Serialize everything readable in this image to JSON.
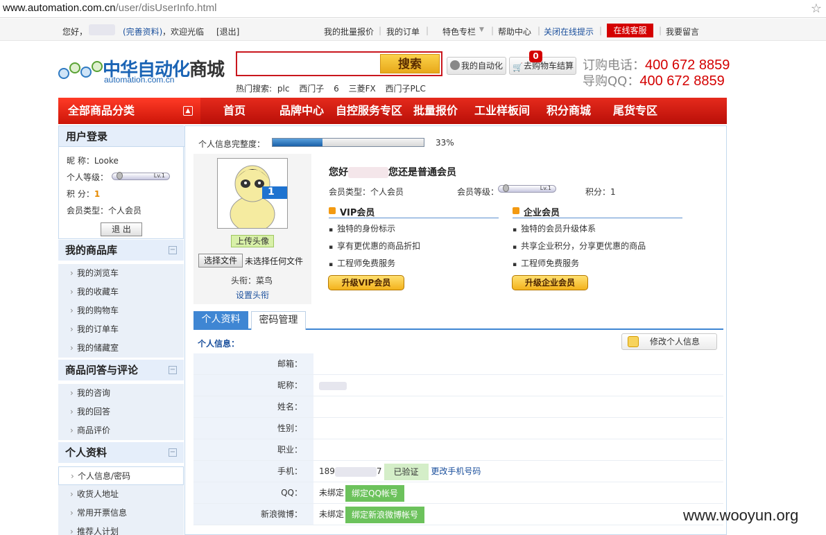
{
  "browser": {
    "url_domain": "www.automation.com.cn",
    "url_path": "/user/disUserInfo.html"
  },
  "topbar": {
    "greeting": "您好，",
    "complete_profile": "(完善资料)",
    "welcome": "，欢迎光临",
    "logout": "[退出]",
    "links": [
      "我的批量报价",
      "我的订单",
      "特色专栏",
      "帮助中心"
    ],
    "close_tip": "关闭在线提示",
    "online_service": "在线客服",
    "leave_message": "我要留言"
  },
  "logo": {
    "cn_blue": "中华自动化",
    "cn_gray": "商城",
    "en": "automation.com.cn"
  },
  "search": {
    "placeholder": "",
    "button": "搜索",
    "hot_label": "热门搜索:",
    "hot": [
      "plc",
      "西门子",
      "6",
      "三菱FX",
      "西门子PLC"
    ]
  },
  "header_buttons": {
    "my_auto": "我的自动化",
    "cart": "去购物车结算",
    "cart_count": "0"
  },
  "phone": {
    "order_label": "订购电话：",
    "order_number": "400 672 8859",
    "qq_label": "导购QQ：",
    "qq_number": "400 672 8859"
  },
  "nav": {
    "all": "全部商品分类",
    "items": [
      "首页",
      "品牌中心",
      "自控服务专区",
      "批量报价",
      "工业样板间",
      "积分商城",
      "尾货专区"
    ]
  },
  "sidebar": {
    "login_title": "用户登录",
    "nick_label": "昵 称：",
    "nick": "Looke",
    "level_label": "个人等级：",
    "points_label": "积 分：",
    "points": "1",
    "type_label": "会员类型：",
    "type": "个人会员",
    "logout_btn": "退 出",
    "sections": [
      {
        "title": "我的商品库",
        "items": [
          "我的浏览车",
          "我的收藏车",
          "我的购物车",
          "我的订单车",
          "我的储藏室"
        ]
      },
      {
        "title": "商品问答与评论",
        "items": [
          "我的咨询",
          "我的回答",
          "商品评价"
        ]
      },
      {
        "title": "个人资料",
        "items": [
          "个人信息/密码",
          "收货人地址",
          "常用开票信息",
          "推荐人计划"
        ]
      }
    ]
  },
  "profile": {
    "completeness_label": "个人信息完整度：",
    "completeness_value": "33%",
    "completeness_fraction": 0.33,
    "upload_avatar": "上传头像",
    "choose_file": "选择文件",
    "no_file": "未选择任何文件",
    "title_label": "头衔：菜鸟",
    "set_title": "设置头衔",
    "avatar_badge": "1",
    "hello_a": "您好",
    "hello_b": "您还是普通会员",
    "member_type": "会员类型：个人会员",
    "member_level": "会员等级：",
    "points": "积分：1",
    "level_tag": "Lv.1",
    "vip": {
      "title": "VIP会员",
      "bullets": [
        "独特的身份标示",
        "享有更优惠的商品折扣",
        "工程师免费服务"
      ],
      "button": "升级VIP会员"
    },
    "ent": {
      "title": "企业会员",
      "bullets": [
        "独特的会员升级体系",
        "共享企业积分，分享更优惠的商品",
        "工程师免费服务"
      ],
      "button": "升级企业会员"
    }
  },
  "tabs": {
    "active": "个人资料",
    "inactive": "密码管理"
  },
  "info": {
    "title": "个人信息：",
    "edit_button": "修改个人信息",
    "rows": {
      "email": "邮箱：",
      "nick": "昵称：",
      "name": "姓名：",
      "gender": "性别：",
      "job": "职业：",
      "phone": "手机：",
      "qq": "QQ：",
      "weibo": "新浪微博："
    },
    "phone_a": "189",
    "phone_b": "7",
    "verified": "已验证",
    "change_phone": "更改手机号码",
    "unbound": "未绑定",
    "bind_qq": "绑定QQ帐号",
    "bind_weibo": "绑定新浪微博帐号"
  },
  "watermark": "www.wooyun.org"
}
